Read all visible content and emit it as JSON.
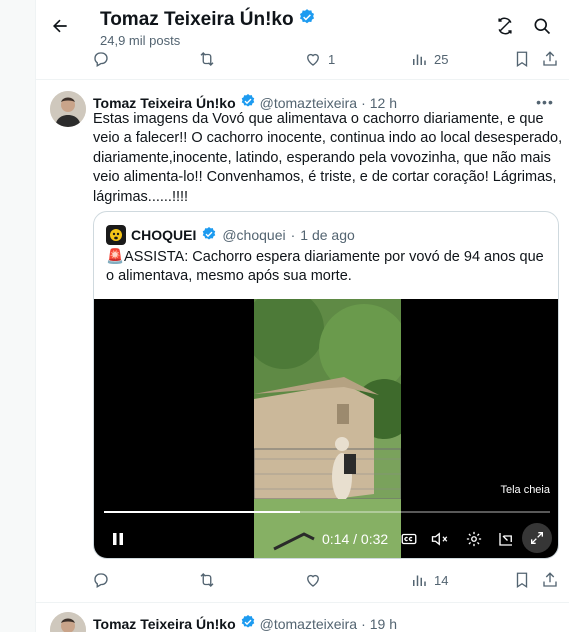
{
  "header": {
    "title": "Tomaz Teixeira Ún!ko",
    "subtitle": "24,9 mil posts",
    "icons": [
      "back-arrow-icon",
      "verified-badge-icon",
      "refresh-icon",
      "search-icon"
    ]
  },
  "prev_actions": {
    "reply": "",
    "retweet": "",
    "likes": "1",
    "views": "25"
  },
  "tweet": {
    "name": "Tomaz Teixeira Ún!ko",
    "handle": "@tomazteixeira",
    "dot": "·",
    "time": "12 h",
    "more": "•••",
    "text": "Estas imagens da Vovó que alimentava o cachorro diariamente, e que veio a falecer!! O cachorro inocente, continua indo ao local desesperado, diariamente,inocente, latindo, esperando pela vovozinha, que não mais veio alimenta-lo!! Convenhamos, é triste, e de cortar coração! Lágrimas, lágrimas......!!!!",
    "quote": {
      "name": "CHOQUEI",
      "handle": "@choquei",
      "dot": "·",
      "time": "1 de ago",
      "text": "🚨ASSISTA: Cachorro espera diariamente por vovó de 94 anos que o alimentava, mesmo após sua morte.",
      "video": {
        "fullscreen_label": "Tela cheia",
        "time_display": "0:14 / 0:32",
        "progress": 0.44,
        "controls": [
          "pause-icon",
          "captions-icon",
          "mute-icon",
          "settings-icon",
          "pip-icon",
          "expand-icon"
        ]
      }
    },
    "actions": {
      "reply": "",
      "retweet": "",
      "likes": "",
      "views": "14"
    }
  },
  "next_tweet": {
    "name": "Tomaz Teixeira Ún!ko",
    "handle": "@tomazteixeira",
    "dot": "·",
    "time": "19 h"
  },
  "colors": {
    "verified": "#1d9bf0",
    "secondary_text": "#536471",
    "border": "#cfd9de"
  }
}
